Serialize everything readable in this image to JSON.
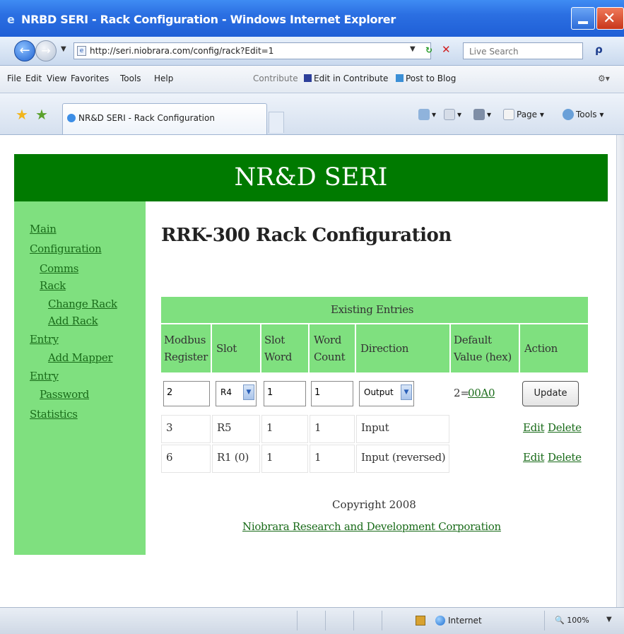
{
  "window": {
    "title": "NRBD SERI - Rack Configuration - Windows Internet Explorer"
  },
  "address": {
    "url": "http://seri.niobrara.com/config/rack?Edit=1",
    "search_placeholder": "Live Search"
  },
  "menu": {
    "items": [
      "File",
      "Edit",
      "View",
      "Favorites",
      "Tools",
      "Help"
    ],
    "contribute": "Contribute",
    "edit_in_contribute": "Edit in Contribute",
    "post_to_blog": "Post to Blog"
  },
  "tab": {
    "label": "NR&D SERI - Rack Configuration"
  },
  "command_bar": {
    "page": "Page",
    "tools": "Tools"
  },
  "page": {
    "banner": "NR&D SERI",
    "title": "RRK-300 Rack Configuration",
    "sidebar": [
      "Main",
      "Configuration",
      "Comms",
      "Rack",
      "Change Rack",
      "Add Rack",
      "Entry",
      "Add Mapper",
      "Entry",
      "Password",
      "Statistics"
    ],
    "table": {
      "caption": "Existing Entries",
      "headers": {
        "modbus": [
          "Modbus",
          "Register"
        ],
        "slot": "Slot",
        "slot_word": [
          "Slot",
          "Word"
        ],
        "word_count": [
          "Word",
          "Count"
        ],
        "direction": "Direction",
        "default_value": [
          "Default",
          "Value (hex)"
        ],
        "action": "Action"
      },
      "edit_row": {
        "modbus": "2",
        "slot": "R4",
        "slot_word": "1",
        "word_count": "1",
        "direction": "Output",
        "default_prefix": "2=",
        "default_link": "00A0",
        "button": "Update"
      },
      "rows": [
        {
          "modbus": "3",
          "slot": "R5",
          "slot_word": "1",
          "word_count": "1",
          "direction": "Input",
          "edit": "Edit",
          "delete": "Delete"
        },
        {
          "modbus": "6",
          "slot": "R1 (0)",
          "slot_word": "1",
          "word_count": "1",
          "direction": "Input (reversed)",
          "edit": "Edit",
          "delete": "Delete"
        }
      ]
    },
    "copyright": "Copyright 2008",
    "company_link": "Niobrara Research and Development Corporation"
  },
  "status": {
    "zone": "Internet",
    "zoom": "100%"
  },
  "colors": {
    "banner": "#007a00",
    "sidebar": "#7fe07f",
    "link": "#196b19"
  }
}
